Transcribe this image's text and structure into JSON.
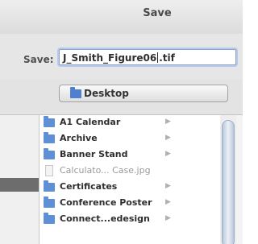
{
  "dialog": {
    "title": "Save"
  },
  "save_as": {
    "label": "Save:",
    "value_before_caret": "J_Smith_Figure06",
    "value_after_caret": ".tif"
  },
  "location": {
    "label": "Desktop",
    "icon": "folder-icon"
  },
  "files": [
    {
      "label": "A1 Calendar",
      "type": "folder",
      "icon": "folder-icon"
    },
    {
      "label": "Archive",
      "type": "folder",
      "icon": "folder-icon"
    },
    {
      "label": "Banner Stand",
      "type": "folder",
      "icon": "folder-icon"
    },
    {
      "label": "Calculato... Case.jpg",
      "type": "file",
      "icon": "document-icon"
    },
    {
      "label": "Certificates",
      "type": "folder",
      "icon": "folder-icon"
    },
    {
      "label": "Conference Poster",
      "type": "folder",
      "icon": "folder-icon"
    },
    {
      "label": "Connect...edesign",
      "type": "folder",
      "icon": "folder-icon"
    }
  ],
  "colors": {
    "accent": "#5f8fd4",
    "focus_ring": "#b7c9ea"
  }
}
